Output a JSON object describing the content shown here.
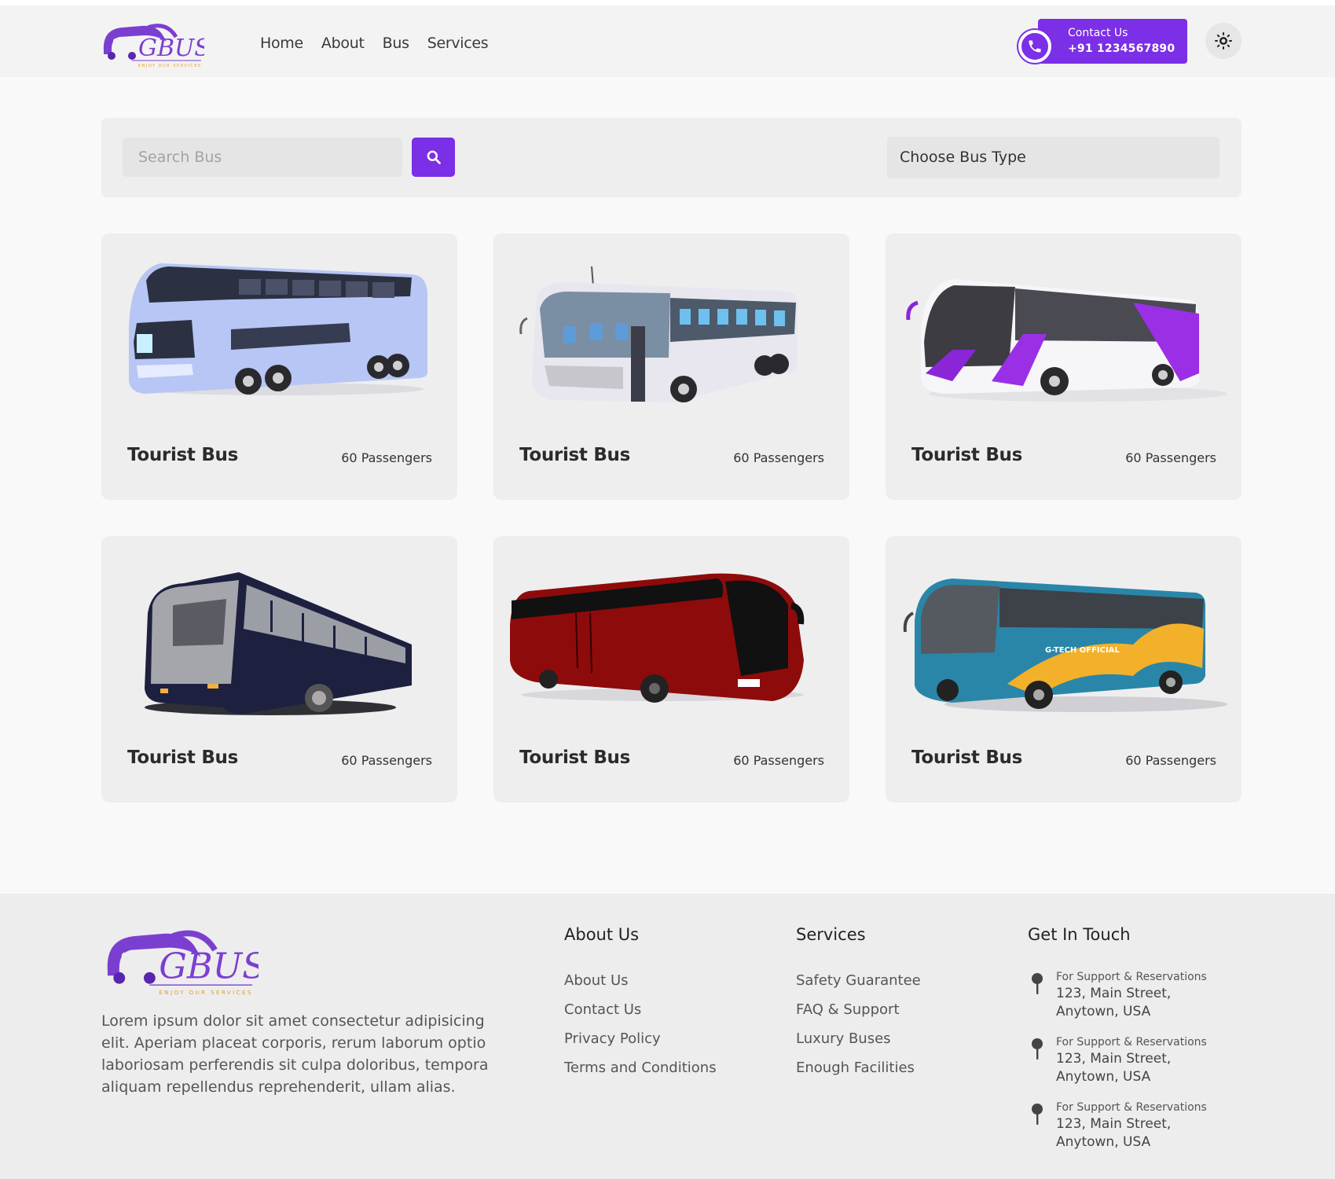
{
  "brand": {
    "logo_text": "GBUS",
    "tagline": "ENJOY OUR SERVICES",
    "accent": "#7b2fe6"
  },
  "nav": {
    "items": [
      "Home",
      "About",
      "Bus",
      "Services"
    ]
  },
  "header": {
    "contact_label": "Contact Us",
    "contact_phone": "+91 1234567890"
  },
  "search": {
    "placeholder": "Search Bus",
    "bus_type_label": "Choose Bus Type"
  },
  "cards": [
    {
      "title": "Tourist Bus",
      "passengers": "60 Passengers",
      "image": "double-decker-bus"
    },
    {
      "title": "Tourist Bus",
      "passengers": "60 Passengers",
      "image": "white-coach-bus"
    },
    {
      "title": "Tourist Bus",
      "passengers": "60 Passengers",
      "image": "white-purple-coach-bus"
    },
    {
      "title": "Tourist Bus",
      "passengers": "60 Passengers",
      "image": "navy-coach-bus"
    },
    {
      "title": "Tourist Bus",
      "passengers": "60 Passengers",
      "image": "red-coach-bus"
    },
    {
      "title": "Tourist Bus",
      "passengers": "60 Passengers",
      "image": "blue-yellow-coach-bus"
    }
  ],
  "bus_livery": {
    "blue_yellow_bus_text": "G-TECH OFFICIAL"
  },
  "footer": {
    "description": "Lorem ipsum dolor sit amet consectetur adipisicing elit. Aperiam placeat corporis, rerum laborum optio laboriosam perferendis sit culpa doloribus, tempora aliquam repellendus reprehenderit, ullam alias.",
    "about": {
      "title": "About Us",
      "links": [
        "About Us",
        "Contact Us",
        "Privacy Policy",
        "Terms and Conditions"
      ]
    },
    "services": {
      "title": "Services",
      "links": [
        "Safety Guarantee",
        "FAQ & Support",
        "Luxury Buses",
        "Enough Facilities"
      ]
    },
    "contact": {
      "title": "Get In Touch",
      "items": [
        {
          "label": "For Support & Reservations",
          "address": "123, Main Street, Anytown, USA"
        },
        {
          "label": "For Support & Reservations",
          "address": "123, Main Street, Anytown, USA"
        },
        {
          "label": "For Support & Reservations",
          "address": "123, Main Street, Anytown, USA"
        }
      ]
    }
  }
}
